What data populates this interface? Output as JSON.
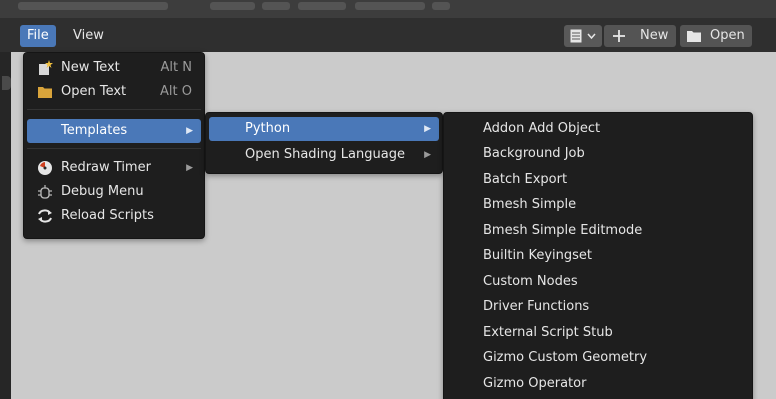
{
  "header": {
    "menus": [
      "File",
      "View"
    ],
    "new_button": "New",
    "open_button": "Open"
  },
  "file_menu": {
    "items": [
      {
        "label": "New Text",
        "shortcut": "Alt N",
        "icon": "new-document-icon"
      },
      {
        "label": "Open Text",
        "shortcut": "Alt O",
        "icon": "folder-icon"
      },
      {
        "label": "Templates",
        "submenu": true
      },
      {
        "label": "Redraw Timer",
        "submenu": true,
        "icon": "timer-icon"
      },
      {
        "label": "Debug Menu",
        "icon": "debug-icon"
      },
      {
        "label": "Reload Scripts",
        "icon": "reload-icon"
      }
    ]
  },
  "templates_menu": {
    "items": [
      {
        "label": "Python",
        "submenu": true
      },
      {
        "label": "Open Shading Language",
        "submenu": true
      }
    ]
  },
  "python_menu": {
    "items": [
      "Addon Add Object",
      "Background Job",
      "Batch Export",
      "Bmesh Simple",
      "Bmesh Simple Editmode",
      "Builtin Keyingset",
      "Custom Nodes",
      "Driver Functions",
      "External Script Stub",
      "Gizmo Custom Geometry",
      "Gizmo Operator"
    ]
  },
  "colors": {
    "accent": "#4a78b8",
    "menu_bg": "#1e1e1e",
    "canvas_bg": "#cbcbcb"
  }
}
